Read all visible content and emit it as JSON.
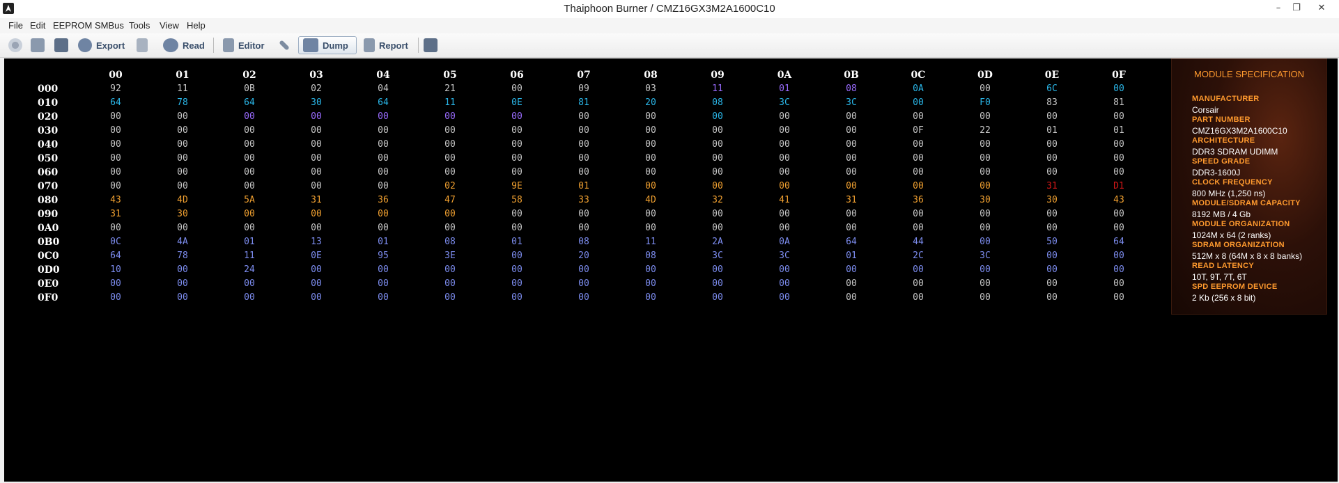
{
  "window": {
    "title": "Thaiphoon Burner / CMZ16GX3M2A1600C10",
    "minimize": "–",
    "restore": "❐",
    "close": "✕"
  },
  "menu": [
    "File",
    "Edit",
    "EEPROM",
    "SMBus",
    "Tools",
    "View",
    "Help"
  ],
  "toolbar": {
    "export": "Export",
    "read": "Read",
    "editor": "Editor",
    "dump": "Dump",
    "report": "Report"
  },
  "dump": {
    "columns": [
      "00",
      "01",
      "02",
      "03",
      "04",
      "05",
      "06",
      "07",
      "08",
      "09",
      "0A",
      "0B",
      "0C",
      "0D",
      "0E",
      "0F"
    ],
    "rows": [
      {
        "addr": "000",
        "values": [
          "92",
          "11",
          "0B",
          "02",
          "04",
          "21",
          "00",
          "09",
          "03",
          "11",
          "01",
          "08",
          "0A",
          "00",
          "6C",
          "00"
        ]
      },
      {
        "addr": "010",
        "values": [
          "64",
          "78",
          "64",
          "30",
          "64",
          "11",
          "0E",
          "81",
          "20",
          "08",
          "3C",
          "3C",
          "00",
          "F0",
          "83",
          "81"
        ]
      },
      {
        "addr": "020",
        "values": [
          "00",
          "00",
          "00",
          "00",
          "00",
          "00",
          "00",
          "00",
          "00",
          "00",
          "00",
          "00",
          "00",
          "00",
          "00",
          "00"
        ]
      },
      {
        "addr": "030",
        "values": [
          "00",
          "00",
          "00",
          "00",
          "00",
          "00",
          "00",
          "00",
          "00",
          "00",
          "00",
          "00",
          "0F",
          "22",
          "01",
          "01"
        ]
      },
      {
        "addr": "040",
        "values": [
          "00",
          "00",
          "00",
          "00",
          "00",
          "00",
          "00",
          "00",
          "00",
          "00",
          "00",
          "00",
          "00",
          "00",
          "00",
          "00"
        ]
      },
      {
        "addr": "050",
        "values": [
          "00",
          "00",
          "00",
          "00",
          "00",
          "00",
          "00",
          "00",
          "00",
          "00",
          "00",
          "00",
          "00",
          "00",
          "00",
          "00"
        ]
      },
      {
        "addr": "060",
        "values": [
          "00",
          "00",
          "00",
          "00",
          "00",
          "00",
          "00",
          "00",
          "00",
          "00",
          "00",
          "00",
          "00",
          "00",
          "00",
          "00"
        ]
      },
      {
        "addr": "070",
        "values": [
          "00",
          "00",
          "00",
          "00",
          "00",
          "02",
          "9E",
          "01",
          "00",
          "00",
          "00",
          "00",
          "00",
          "00",
          "31",
          "D1"
        ]
      },
      {
        "addr": "080",
        "values": [
          "43",
          "4D",
          "5A",
          "31",
          "36",
          "47",
          "58",
          "33",
          "4D",
          "32",
          "41",
          "31",
          "36",
          "30",
          "30",
          "43"
        ]
      },
      {
        "addr": "090",
        "values": [
          "31",
          "30",
          "00",
          "00",
          "00",
          "00",
          "00",
          "00",
          "00",
          "00",
          "00",
          "00",
          "00",
          "00",
          "00",
          "00"
        ]
      },
      {
        "addr": "0A0",
        "values": [
          "00",
          "00",
          "00",
          "00",
          "00",
          "00",
          "00",
          "00",
          "00",
          "00",
          "00",
          "00",
          "00",
          "00",
          "00",
          "00"
        ]
      },
      {
        "addr": "0B0",
        "values": [
          "0C",
          "4A",
          "01",
          "13",
          "01",
          "08",
          "01",
          "08",
          "11",
          "2A",
          "0A",
          "64",
          "44",
          "00",
          "50",
          "64"
        ]
      },
      {
        "addr": "0C0",
        "values": [
          "64",
          "78",
          "11",
          "0E",
          "95",
          "3E",
          "00",
          "20",
          "08",
          "3C",
          "3C",
          "01",
          "2C",
          "3C",
          "00",
          "00"
        ]
      },
      {
        "addr": "0D0",
        "values": [
          "10",
          "00",
          "24",
          "00",
          "00",
          "00",
          "00",
          "00",
          "00",
          "00",
          "00",
          "00",
          "00",
          "00",
          "00",
          "00"
        ]
      },
      {
        "addr": "0E0",
        "values": [
          "00",
          "00",
          "00",
          "00",
          "00",
          "00",
          "00",
          "00",
          "00",
          "00",
          "00",
          "00",
          "00",
          "00",
          "00",
          "00"
        ]
      },
      {
        "addr": "0F0",
        "values": [
          "00",
          "00",
          "00",
          "00",
          "00",
          "00",
          "00",
          "00",
          "00",
          "00",
          "00",
          "00",
          "00",
          "00",
          "00",
          "00"
        ]
      }
    ],
    "colors": [
      [
        "#c8c8c8",
        "#c8c8c8",
        "#c8c8c8",
        "#c8c8c8",
        "#c8c8c8",
        "#c8c8c8",
        "#c8c8c8",
        "#c8c8c8",
        "#c8c8c8",
        "#9a6cff",
        "#9a6cff",
        "#9a6cff",
        "#2ab6e8",
        "#c8c8c8",
        "#2ab6e8",
        "#2ab6e8"
      ],
      [
        "#2ab6e8",
        "#2ab6e8",
        "#2ab6e8",
        "#2ab6e8",
        "#2ab6e8",
        "#2ab6e8",
        "#2ab6e8",
        "#2ab6e8",
        "#2ab6e8",
        "#2ab6e8",
        "#2ab6e8",
        "#2ab6e8",
        "#2ab6e8",
        "#2ab6e8",
        "#c8c8c8",
        "#c8c8c8"
      ],
      [
        "#c8c8c8",
        "#c8c8c8",
        "#9a6cff",
        "#9a6cff",
        "#9a6cff",
        "#9a6cff",
        "#9a6cff",
        "#c8c8c8",
        "#c8c8c8",
        "#2ab6e8",
        "#c8c8c8",
        "#c8c8c8",
        "#c8c8c8",
        "#c8c8c8",
        "#c8c8c8",
        "#c8c8c8"
      ],
      [
        "#c8c8c8",
        "#c8c8c8",
        "#c8c8c8",
        "#c8c8c8",
        "#c8c8c8",
        "#c8c8c8",
        "#c8c8c8",
        "#c8c8c8",
        "#c8c8c8",
        "#c8c8c8",
        "#c8c8c8",
        "#c8c8c8",
        "#c8c8c8",
        "#c8c8c8",
        "#c8c8c8",
        "#c8c8c8"
      ],
      [
        "#c8c8c8",
        "#c8c8c8",
        "#c8c8c8",
        "#c8c8c8",
        "#c8c8c8",
        "#c8c8c8",
        "#c8c8c8",
        "#c8c8c8",
        "#c8c8c8",
        "#c8c8c8",
        "#c8c8c8",
        "#c8c8c8",
        "#c8c8c8",
        "#c8c8c8",
        "#c8c8c8",
        "#c8c8c8"
      ],
      [
        "#c8c8c8",
        "#c8c8c8",
        "#c8c8c8",
        "#c8c8c8",
        "#c8c8c8",
        "#c8c8c8",
        "#c8c8c8",
        "#c8c8c8",
        "#c8c8c8",
        "#c8c8c8",
        "#c8c8c8",
        "#c8c8c8",
        "#c8c8c8",
        "#c8c8c8",
        "#c8c8c8",
        "#c8c8c8"
      ],
      [
        "#c8c8c8",
        "#c8c8c8",
        "#c8c8c8",
        "#c8c8c8",
        "#c8c8c8",
        "#c8c8c8",
        "#c8c8c8",
        "#c8c8c8",
        "#c8c8c8",
        "#c8c8c8",
        "#c8c8c8",
        "#c8c8c8",
        "#c8c8c8",
        "#c8c8c8",
        "#c8c8c8",
        "#c8c8c8"
      ],
      [
        "#c8c8c8",
        "#c8c8c8",
        "#c8c8c8",
        "#c8c8c8",
        "#c8c8c8",
        "#f0a030",
        "#f0a030",
        "#f0a030",
        "#f0a030",
        "#f0a030",
        "#f0a030",
        "#f0a030",
        "#f0a030",
        "#f0a030",
        "#d81818",
        "#d81818"
      ],
      [
        "#f0a030",
        "#f0a030",
        "#f0a030",
        "#f0a030",
        "#f0a030",
        "#f0a030",
        "#f0a030",
        "#f0a030",
        "#f0a030",
        "#f0a030",
        "#f0a030",
        "#f0a030",
        "#f0a030",
        "#f0a030",
        "#f0a030",
        "#f0a030"
      ],
      [
        "#f0a030",
        "#f0a030",
        "#f0a030",
        "#f0a030",
        "#f0a030",
        "#f0a030",
        "#c8c8c8",
        "#c8c8c8",
        "#c8c8c8",
        "#c8c8c8",
        "#c8c8c8",
        "#c8c8c8",
        "#c8c8c8",
        "#c8c8c8",
        "#c8c8c8",
        "#c8c8c8"
      ],
      [
        "#c8c8c8",
        "#c8c8c8",
        "#c8c8c8",
        "#c8c8c8",
        "#c8c8c8",
        "#c8c8c8",
        "#c8c8c8",
        "#c8c8c8",
        "#c8c8c8",
        "#c8c8c8",
        "#c8c8c8",
        "#c8c8c8",
        "#c8c8c8",
        "#c8c8c8",
        "#c8c8c8",
        "#c8c8c8"
      ],
      [
        "#7d8df0",
        "#7d8df0",
        "#7d8df0",
        "#7d8df0",
        "#7d8df0",
        "#7d8df0",
        "#7d8df0",
        "#7d8df0",
        "#7d8df0",
        "#7d8df0",
        "#7d8df0",
        "#7d8df0",
        "#7d8df0",
        "#7d8df0",
        "#7d8df0",
        "#7d8df0"
      ],
      [
        "#7d8df0",
        "#7d8df0",
        "#7d8df0",
        "#7d8df0",
        "#7d8df0",
        "#7d8df0",
        "#7d8df0",
        "#7d8df0",
        "#7d8df0",
        "#7d8df0",
        "#7d8df0",
        "#7d8df0",
        "#7d8df0",
        "#7d8df0",
        "#7d8df0",
        "#7d8df0"
      ],
      [
        "#7d8df0",
        "#7d8df0",
        "#7d8df0",
        "#7d8df0",
        "#7d8df0",
        "#7d8df0",
        "#7d8df0",
        "#7d8df0",
        "#7d8df0",
        "#7d8df0",
        "#7d8df0",
        "#7d8df0",
        "#7d8df0",
        "#7d8df0",
        "#7d8df0",
        "#7d8df0"
      ],
      [
        "#7d8df0",
        "#7d8df0",
        "#7d8df0",
        "#7d8df0",
        "#7d8df0",
        "#7d8df0",
        "#7d8df0",
        "#7d8df0",
        "#7d8df0",
        "#7d8df0",
        "#7d8df0",
        "#c8c8c8",
        "#c8c8c8",
        "#c8c8c8",
        "#c8c8c8",
        "#c8c8c8"
      ],
      [
        "#7d8df0",
        "#7d8df0",
        "#7d8df0",
        "#7d8df0",
        "#7d8df0",
        "#7d8df0",
        "#7d8df0",
        "#7d8df0",
        "#7d8df0",
        "#7d8df0",
        "#7d8df0",
        "#c8c8c8",
        "#c8c8c8",
        "#c8c8c8",
        "#c8c8c8",
        "#c8c8c8"
      ]
    ]
  },
  "spec": {
    "title": "MODULE SPECIFICATION",
    "items": [
      {
        "label": "MANUFACTURER",
        "value": "Corsair"
      },
      {
        "label": "PART NUMBER",
        "value": "CMZ16GX3M2A1600C10"
      },
      {
        "label": "ARCHITECTURE",
        "value": "DDR3 SDRAM UDIMM"
      },
      {
        "label": "SPEED GRADE",
        "value": "DDR3-1600J"
      },
      {
        "label": "CLOCK FREQUENCY",
        "value": "800 MHz (1,250 ns)"
      },
      {
        "label": "MODULE/SDRAM CAPACITY",
        "value": "8192 MB / 4 Gb"
      },
      {
        "label": "MODULE ORGANIZATION",
        "value": "1024M x 64 (2 ranks)"
      },
      {
        "label": "SDRAM ORGANIZATION",
        "value": "512M x 8 (64M x 8 x 8 banks)"
      },
      {
        "label": "READ LATENCY",
        "value": "10T, 9T, 7T, 6T"
      },
      {
        "label": "SPD EEPROM DEVICE",
        "value": "2 Kb (256 x 8 bit)"
      }
    ]
  }
}
